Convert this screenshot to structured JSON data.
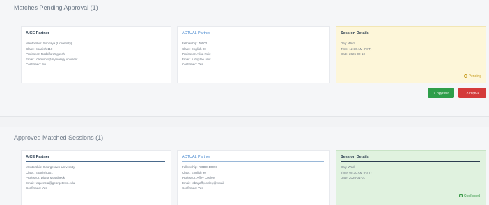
{
  "pending": {
    "title": "Matches Pending Approval (1)",
    "aiced": {
      "title": "AICE Partner",
      "lines": [
        "Mentorship: Sonzaya (University)",
        "Class: Spanish 110",
        "Professor: Rodolfo Ungleich",
        "Email: rcaptions@mybiology.universit",
        "Confirmed: No"
      ]
    },
    "actual": {
      "title": "ACTUAL Partner",
      "lines": [
        "Fellowship: 70002",
        "Class: English 90",
        "Professor: Alisa Ruiz",
        "Email: ruiz@the.univ",
        "Confirmed: Yes"
      ]
    },
    "session": {
      "title": "Session Details",
      "lines": [
        "Day: Wed",
        "Time: 12:30 AM (PST)",
        "Date: 2026-02-10"
      ],
      "status": "Pending"
    },
    "approve_label": "✓ Approve",
    "reject_label": "✕ Reject"
  },
  "approved": {
    "title": "Approved Matched Sessions (1)",
    "aiced": {
      "title": "AICE Partner",
      "lines": [
        "Mentorship: Georgetown University",
        "Class: Spanish 201",
        "Professor: Diana Mussibeck",
        "Email: fequencia@georgetown.edu",
        "Confirmed: Yes"
      ]
    },
    "actual": {
      "title": "ACTUAL Partner",
      "lines": [
        "Fellowship: ROBO-10098",
        "Class: English 90",
        "Professor: Affey Cooley",
        "Email: robayaffyconley@email",
        "Confirmed: Yes"
      ]
    },
    "session": {
      "title": "Session Details",
      "lines": [
        "Day: Wed",
        "Time: 00:30 AM (PST)",
        "Date: 2026-01-01"
      ],
      "status": "Confirmed"
    }
  }
}
